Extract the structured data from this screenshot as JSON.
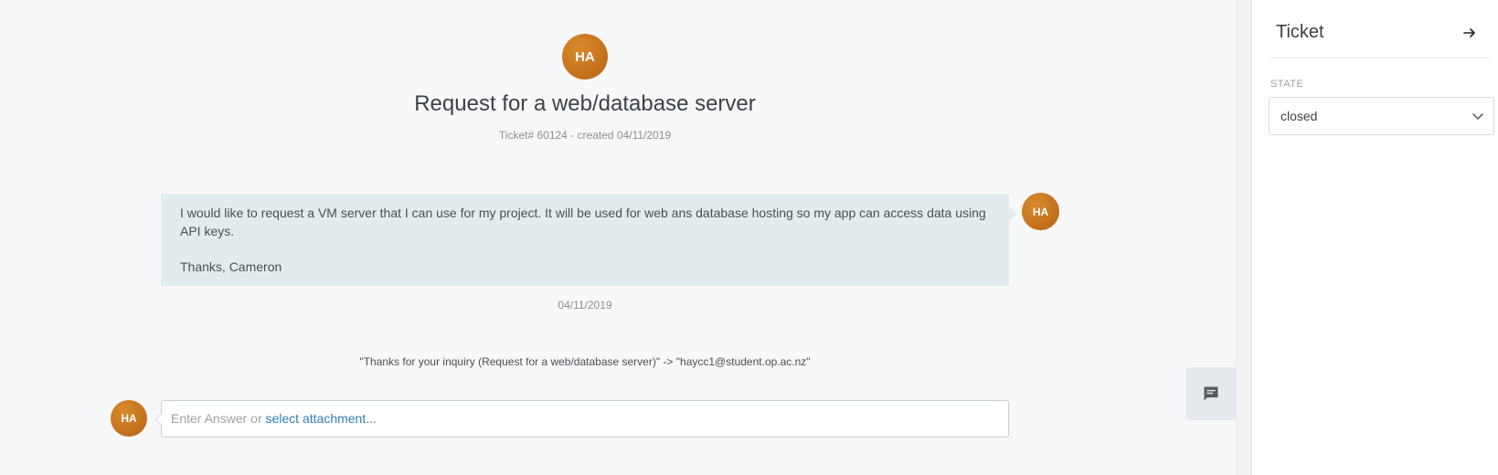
{
  "ticket": {
    "avatar_initials": "HA",
    "title": "Request for a web/database server",
    "meta": "Ticket# 60124 - created 04/11/2019"
  },
  "article": {
    "line1": "I would like to request a VM server that I can use for my project. It will be used for web ans database hosting so my app can access data using API keys.",
    "line2": "Thanks, Cameron",
    "avatar_initials": "HA",
    "date": "04/11/2019"
  },
  "notification": "\"Thanks for your inquiry (Request for a web/database server)\" -> \"haycc1@student.op.ac.nz\"",
  "reply": {
    "avatar_initials": "HA",
    "placeholder": "Enter Answer or",
    "attachment_link": "select attachment..."
  },
  "sidebar": {
    "title": "Ticket",
    "state_label": "STATE",
    "state_value": "closed"
  },
  "colors": {
    "accent_link": "#2f7fb5",
    "avatar": "#c8741f",
    "bubble": "#e2ecef"
  },
  "icons": {
    "sidebar_toggle": "arrow-right-icon",
    "float_button": "chat-message-icon",
    "select": "chevron-down-icon"
  }
}
